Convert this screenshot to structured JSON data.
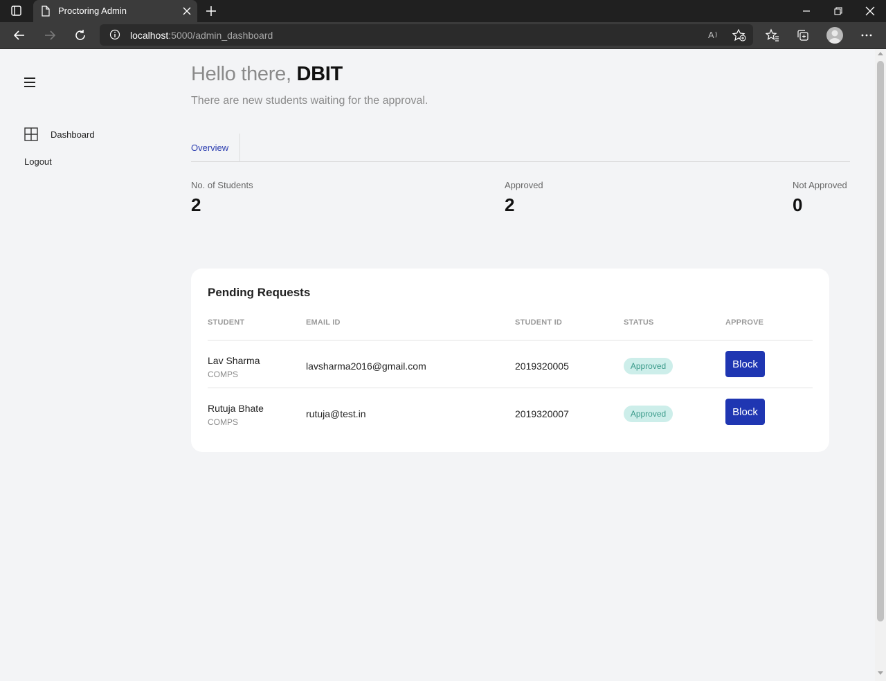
{
  "browser": {
    "tab_title": "Proctoring Admin",
    "url_host": "localhost",
    "url_path": ":5000/admin_dashboard"
  },
  "sidebar": {
    "items": [
      {
        "label": "Dashboard",
        "icon": "grid-icon"
      },
      {
        "label": "Logout"
      }
    ]
  },
  "header": {
    "greeting_prefix": "Hello there, ",
    "greeting_name": "DBIT",
    "subtitle": "There are new students waiting for the approval."
  },
  "tabs": [
    {
      "label": "Overview",
      "active": true
    }
  ],
  "stats": [
    {
      "label": "No. of Students",
      "value": "2"
    },
    {
      "label": "Approved",
      "value": "2"
    },
    {
      "label": "Not Approved",
      "value": "0"
    }
  ],
  "pending": {
    "title": "Pending Requests",
    "columns": [
      "STUDENT",
      "EMAIL ID",
      "STUDENT ID",
      "STATUS",
      "APPROVE"
    ],
    "rows": [
      {
        "name": "Lav Sharma",
        "dept": "COMPS",
        "email": "lavsharma2016@gmail.com",
        "student_id": "2019320005",
        "status": "Approved",
        "action": "Block"
      },
      {
        "name": "Rutuja Bhate",
        "dept": "COMPS",
        "email": "rutuja@test.in",
        "student_id": "2019320007",
        "status": "Approved",
        "action": "Block"
      }
    ]
  },
  "colors": {
    "accent": "#1f36b2",
    "tab_active": "#2b3db0",
    "badge_bg": "#cdeeea",
    "badge_text": "#3a9a8a",
    "page_bg": "#f3f4f6"
  }
}
